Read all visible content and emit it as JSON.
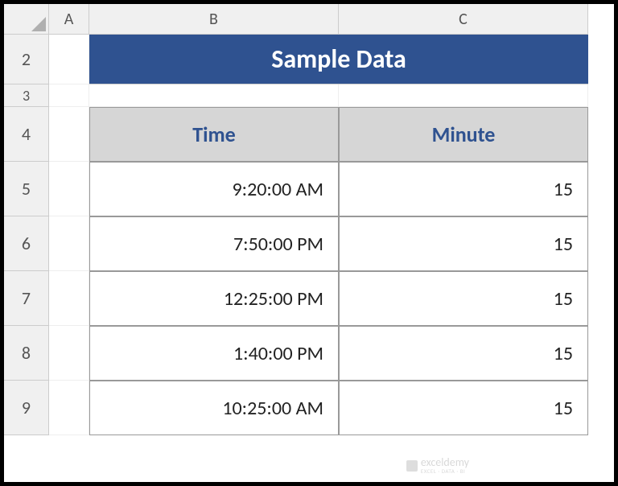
{
  "columns": [
    "A",
    "B",
    "C"
  ],
  "rows": [
    "2",
    "3",
    "4",
    "5",
    "6",
    "7",
    "8",
    "9"
  ],
  "title": "Sample Data",
  "table": {
    "headers": [
      "Time",
      "Minute"
    ],
    "data": [
      {
        "time": "9:20:00 AM",
        "minute": "15"
      },
      {
        "time": "7:50:00 PM",
        "minute": "15"
      },
      {
        "time": "12:25:00 PM",
        "minute": "15"
      },
      {
        "time": "1:40:00 PM",
        "minute": "15"
      },
      {
        "time": "10:25:00 AM",
        "minute": "15"
      }
    ]
  },
  "watermark": {
    "brand": "exceldemy",
    "tagline": "EXCEL · DATA · BI"
  }
}
